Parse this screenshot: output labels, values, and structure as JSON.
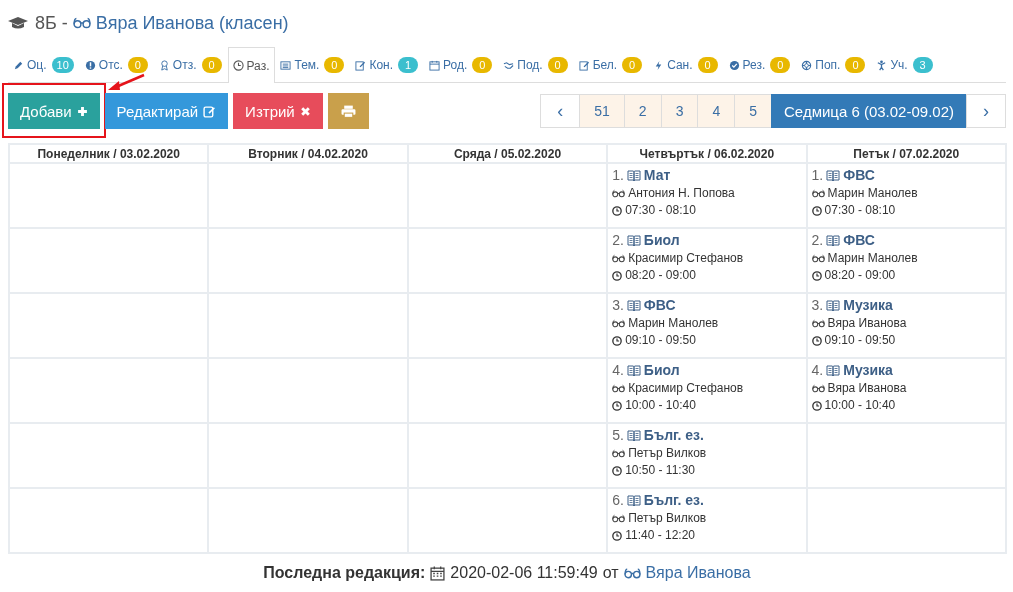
{
  "header": {
    "class_name": "8Б -",
    "teacher": "Вяра Иванова (класен)"
  },
  "tabs": [
    {
      "label": "Оц.",
      "count": "10",
      "color": "#3bbfce",
      "selected": false
    },
    {
      "label": "Отс.",
      "count": "0",
      "color": "#e8b800",
      "selected": false
    },
    {
      "label": "Отз.",
      "count": "0",
      "color": "#e8b800",
      "selected": false
    },
    {
      "label": "Раз.",
      "selected": true
    },
    {
      "label": "Тем.",
      "count": "0",
      "color": "#e8b800",
      "selected": false
    },
    {
      "label": "Кон.",
      "count": "1",
      "color": "#3bbfce",
      "selected": false
    },
    {
      "label": "Род.",
      "count": "0",
      "color": "#e8b800",
      "selected": false
    },
    {
      "label": "Под.",
      "count": "0",
      "color": "#e8b800",
      "selected": false
    },
    {
      "label": "Бел.",
      "count": "0",
      "color": "#e8b800",
      "selected": false
    },
    {
      "label": "Сан.",
      "count": "0",
      "color": "#e8b800",
      "selected": false
    },
    {
      "label": "Рез.",
      "count": "0",
      "color": "#e8b800",
      "selected": false
    },
    {
      "label": "Поп.",
      "count": "0",
      "color": "#e8b800",
      "selected": false
    },
    {
      "label": "Уч.",
      "count": "3",
      "color": "#3bbfce",
      "selected": false
    }
  ],
  "toolbar": [
    {
      "kind": "add",
      "label": "Добави",
      "highlighted": true
    },
    {
      "kind": "edit",
      "label": "Редактирай",
      "highlighted": false
    },
    {
      "kind": "delete",
      "label": "Изтрий",
      "highlighted": false
    },
    {
      "kind": "print",
      "highlighted": false
    }
  ],
  "pagination": [
    {
      "kind": "prev",
      "label": "‹",
      "selected": false
    },
    {
      "kind": "page",
      "label": "51",
      "selected": false
    },
    {
      "kind": "page",
      "label": "2",
      "selected": false
    },
    {
      "kind": "page",
      "label": "3",
      "selected": false
    },
    {
      "kind": "page",
      "label": "4",
      "selected": false
    },
    {
      "kind": "page",
      "label": "5",
      "selected": false
    },
    {
      "kind": "page",
      "label": "Седмица 6 (03.02-09.02)",
      "selected": true
    },
    {
      "kind": "next",
      "label": "›",
      "selected": false
    }
  ],
  "table": {
    "columns": [
      "Понеделник / 03.02.2020",
      "Вторник / 04.02.2020",
      "Сряда / 05.02.2020",
      "Четвъртък / 06.02.2020",
      "Петък / 07.02.2020"
    ],
    "rows": [
      {
        "cells": [
          null,
          null,
          null,
          {
            "number": "1.",
            "subject": "Мат",
            "teacher": "Антония Н. Попова",
            "time": "07:30 - 08:10"
          },
          {
            "number": "1.",
            "subject": "ФВС",
            "teacher": "Марин Манолев",
            "time": "07:30 - 08:10"
          }
        ]
      },
      {
        "cells": [
          null,
          null,
          null,
          {
            "number": "2.",
            "subject": "Биол",
            "teacher": "Красимир Стефанов",
            "time": "08:20 - 09:00"
          },
          {
            "number": "2.",
            "subject": "ФВС",
            "teacher": "Марин Манолев",
            "time": "08:20 - 09:00"
          }
        ]
      },
      {
        "cells": [
          null,
          null,
          null,
          {
            "number": "3.",
            "subject": "ФВС",
            "teacher": "Марин Манолев",
            "time": "09:10 - 09:50"
          },
          {
            "number": "3.",
            "subject": "Музика",
            "teacher": "Вяра Иванова",
            "time": "09:10 - 09:50"
          }
        ]
      },
      {
        "cells": [
          null,
          null,
          null,
          {
            "number": "4.",
            "subject": "Биол",
            "teacher": "Красимир Стефанов",
            "time": "10:00 - 10:40"
          },
          {
            "number": "4.",
            "subject": "Музика",
            "teacher": "Вяра Иванова",
            "time": "10:00 - 10:40"
          }
        ]
      },
      {
        "cells": [
          null,
          null,
          null,
          {
            "number": "5.",
            "subject": "Бълг. ез.",
            "teacher": "Петър Вилков",
            "time": "10:50 - 11:30"
          },
          null
        ]
      },
      {
        "cells": [
          null,
          null,
          null,
          {
            "number": "6.",
            "subject": "Бълг. ез.",
            "teacher": "Петър Вилков",
            "time": "11:40 - 12:20"
          },
          null
        ]
      }
    ]
  },
  "footer": {
    "label": "Последна редакция:",
    "datetime": "2020-02-06 11:59:49",
    "by": "от",
    "author": "Вяра Иванова"
  }
}
